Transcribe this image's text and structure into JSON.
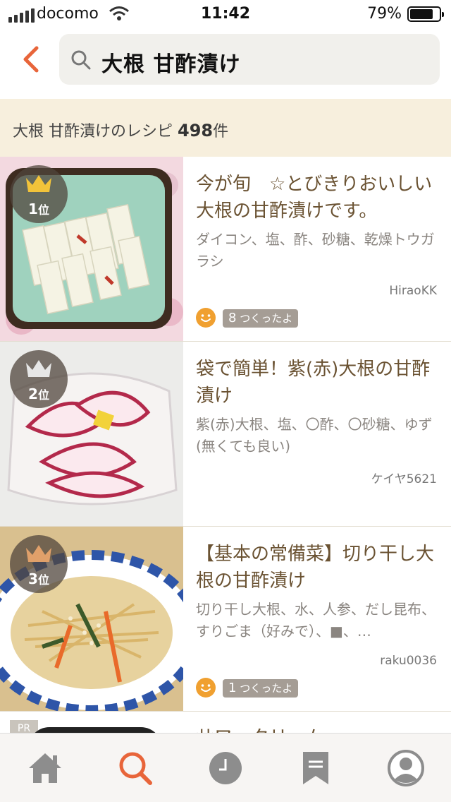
{
  "status_bar": {
    "carrier": "docomo",
    "time": "11:42",
    "battery_percent": "79%",
    "battery_level": 0.79
  },
  "header": {
    "back_icon": "chevron-left-icon",
    "search_icon": "search-icon",
    "search_query": "大根 甘酢漬け"
  },
  "results": {
    "prefix": "大根 甘酢漬けのレシピ ",
    "count": "498",
    "suffix": "件"
  },
  "recipes": [
    {
      "rank_num": "1",
      "rank_suffix": "位",
      "crown_color": "#f2c33a",
      "title": "今が旬　☆とびきりおいしい大根の甘酢漬けです。",
      "ingredients": "ダイコン、塩、酢、砂糖、乾燥トウガラシ",
      "author": "HiraoKK",
      "made_count": "8",
      "made_label": " つくったよ"
    },
    {
      "rank_num": "2",
      "rank_suffix": "位",
      "crown_color": "#e6e6e6",
      "title": "袋で簡単！紫(赤)大根の甘酢漬け",
      "ingredients": "紫(赤)大根、塩、〇酢、〇砂糖、ゆず(無くても良い)",
      "author": "ケイヤ5621"
    },
    {
      "rank_num": "3",
      "rank_suffix": "位",
      "crown_color": "#e0a06a",
      "title": "【基本の常備菜】切り干し大根の甘酢漬け",
      "ingredients": "切り干し大根、水、人参、だし昆布、すりごま（好みで）、■、…",
      "author": "raku0036",
      "made_count": "1",
      "made_label": " つくったよ"
    }
  ],
  "pr_item": {
    "tag": "PR",
    "title": "サワークリーム…"
  },
  "tabbar": [
    {
      "icon": "home-icon",
      "active": false
    },
    {
      "icon": "search-icon",
      "active": true
    },
    {
      "icon": "history-icon",
      "active": false
    },
    {
      "icon": "bookmark-icon",
      "active": false
    },
    {
      "icon": "profile-icon",
      "active": false
    }
  ],
  "colors": {
    "accent": "#e8653a",
    "banner_bg": "#f7efdd",
    "title_text": "#6a5232",
    "smile": "#f0a030"
  }
}
